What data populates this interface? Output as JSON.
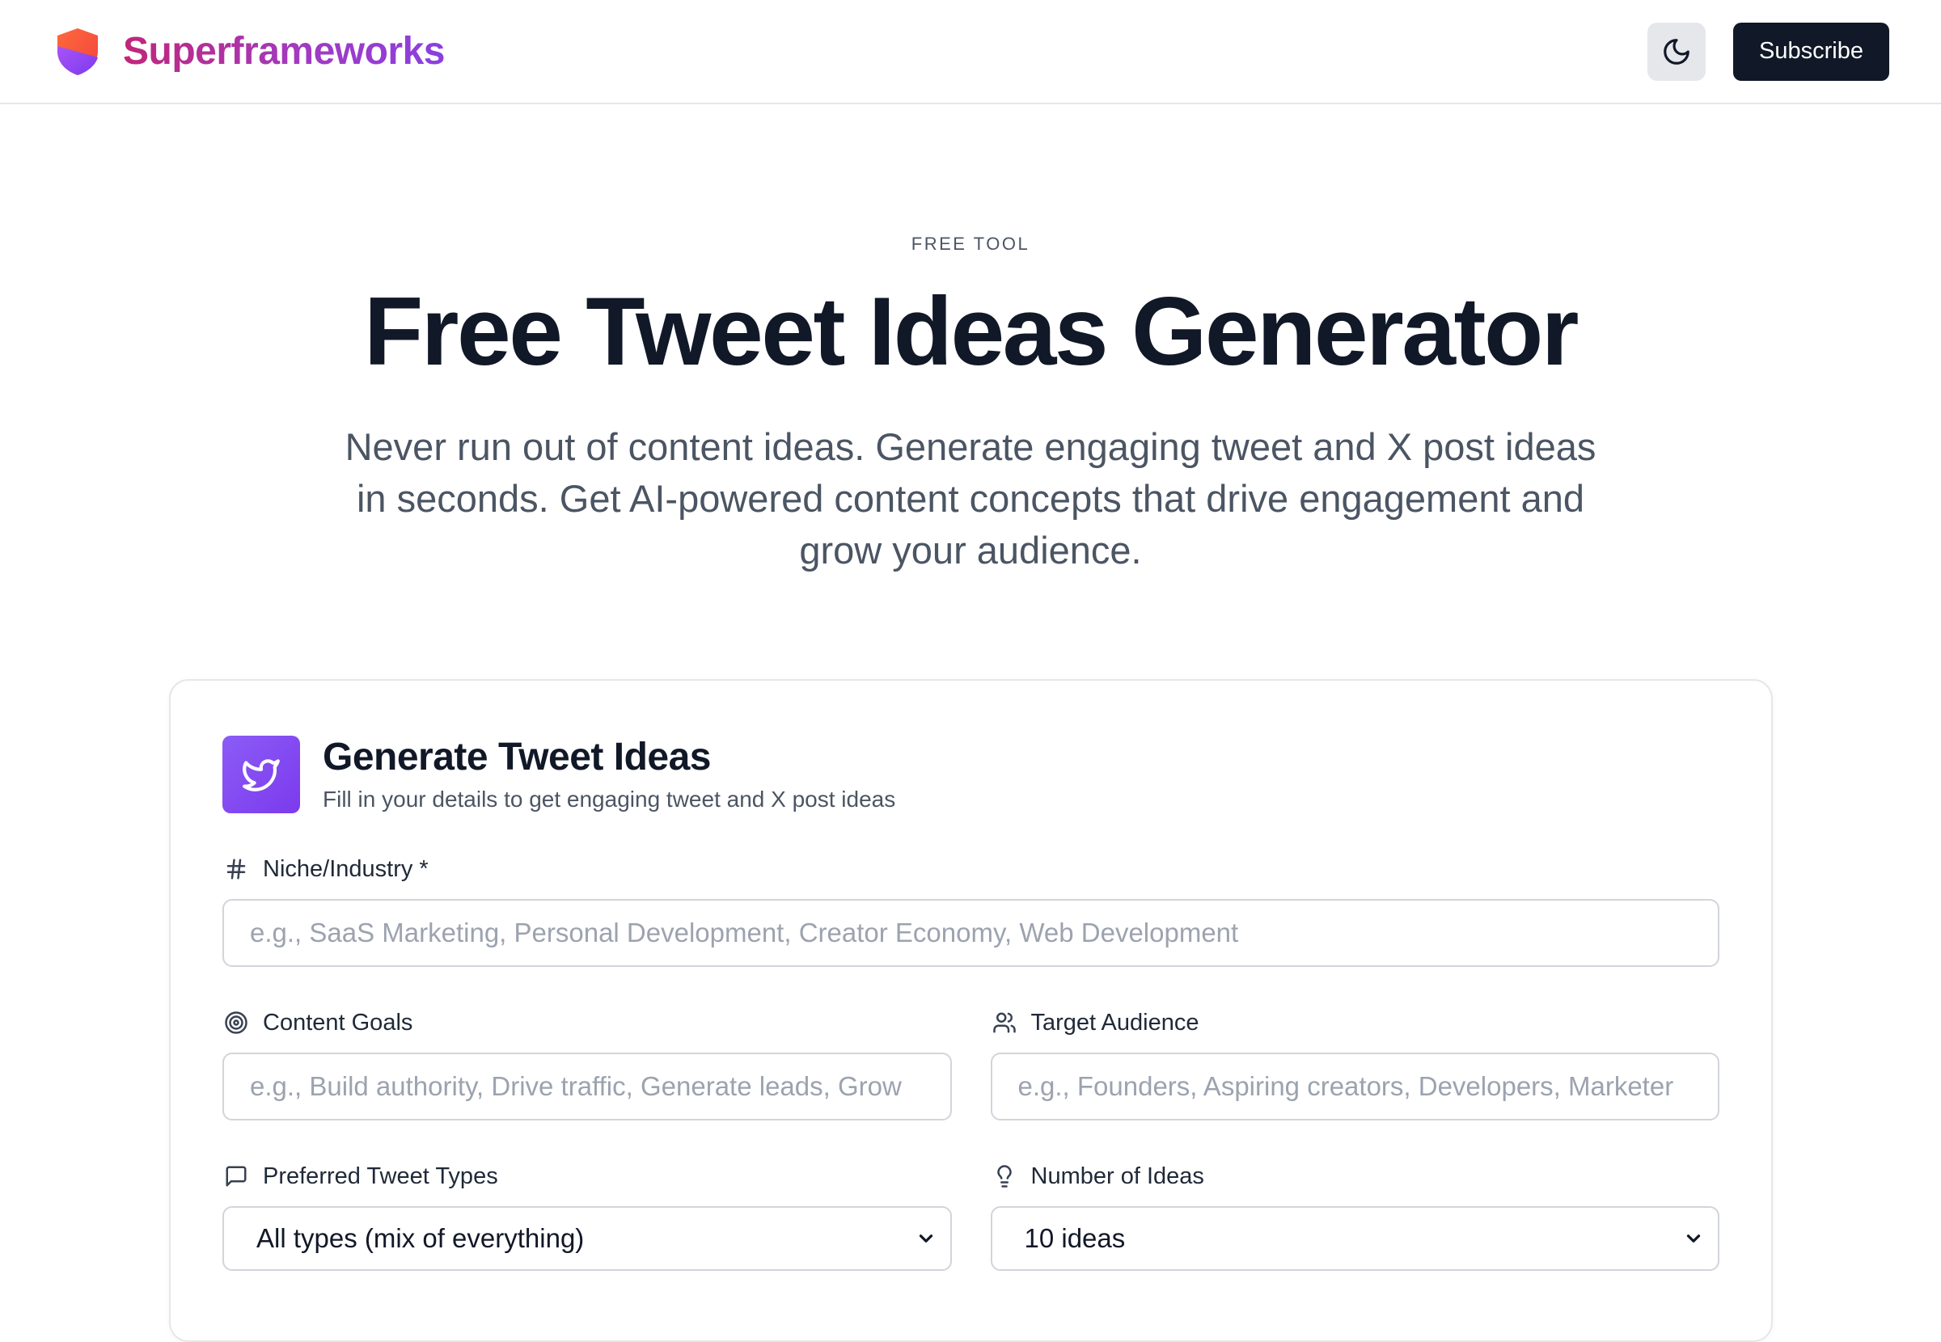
{
  "header": {
    "brand_name": "Superframeworks",
    "subscribe_label": "Subscribe"
  },
  "hero": {
    "eyebrow": "FREE TOOL",
    "title": "Free Tweet Ideas Generator",
    "subtitle": "Never run out of content ideas. Generate engaging tweet and X post ideas in seconds. Get AI-powered content concepts that drive engagement and grow your audience."
  },
  "card": {
    "title": "Generate Tweet Ideas",
    "description": "Fill in your details to get engaging tweet and X post ideas",
    "niche": {
      "label": "Niche/Industry *",
      "placeholder": "e.g., SaaS Marketing, Personal Development, Creator Economy, Web Development"
    },
    "goals": {
      "label": "Content Goals",
      "placeholder": "e.g., Build authority, Drive traffic, Generate leads, Grow"
    },
    "audience": {
      "label": "Target Audience",
      "placeholder": "e.g., Founders, Aspiring creators, Developers, Marketer"
    },
    "tweet_types": {
      "label": "Preferred Tweet Types",
      "selected": "All types (mix of everything)"
    },
    "num_ideas": {
      "label": "Number of Ideas",
      "selected": "10 ideas"
    }
  },
  "colors": {
    "brand_gradient_start": "#c0267a",
    "brand_gradient_end": "#8b3fe0",
    "card_icon_bg": "#7c3aed",
    "dark_button": "#111827"
  },
  "icons": {
    "logo": "shield-logo-icon",
    "theme": "moon-icon",
    "card": "twitter-bird-icon",
    "niche": "hash-icon",
    "goals": "target-icon",
    "audience": "users-icon",
    "tweet_types": "message-square-icon",
    "num_ideas": "lightbulb-icon",
    "dropdown": "chevron-down-icon"
  }
}
